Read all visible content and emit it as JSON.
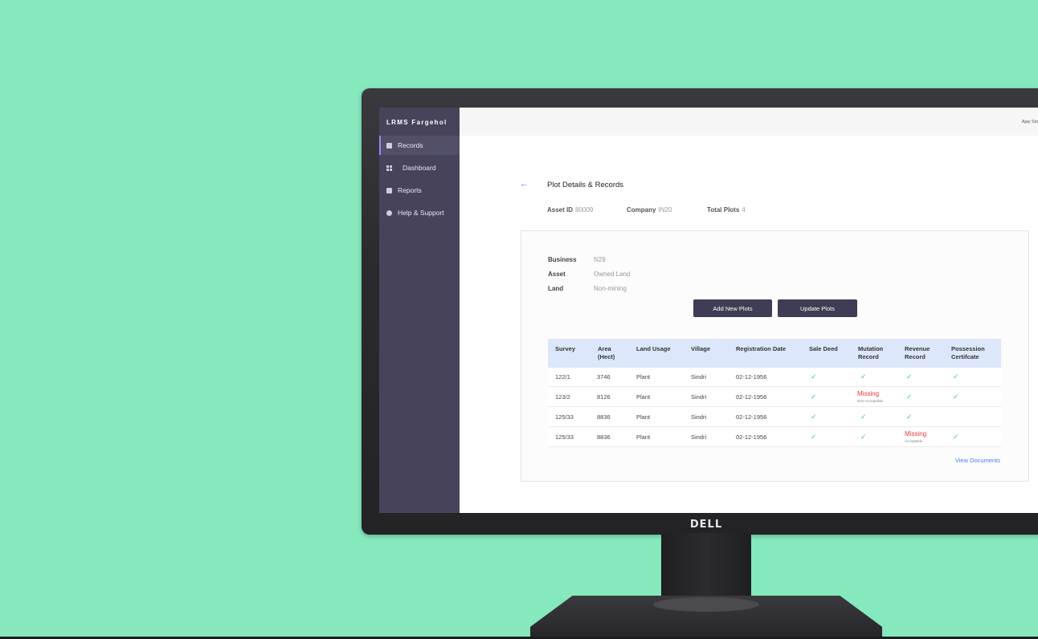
{
  "brand": "DELL",
  "sidebar": {
    "app_title": "LRMS Fargehol",
    "items": [
      {
        "label": "Records",
        "icon": "records-icon"
      },
      {
        "label": "Dashboard",
        "icon": "dashboard-icon"
      },
      {
        "label": "Reports",
        "icon": "reports-icon"
      },
      {
        "label": "Help & Support",
        "icon": "help-icon"
      }
    ]
  },
  "topbar": {
    "user": "Ajay Sin"
  },
  "page": {
    "title": "Plot Details & Records",
    "asset_id_label": "Asset ID",
    "asset_id": "80009",
    "company_label": "Company",
    "company": "IN20",
    "total_plots_label": "Total Plots",
    "total_plots": "4"
  },
  "details": {
    "business_label": "Business",
    "business": "N29",
    "asset_label": "Asset",
    "asset": "Owned Land",
    "land_label": "Land",
    "land": "Non-mining"
  },
  "buttons": {
    "add": "Add New Plots",
    "update": "Update Plots"
  },
  "table": {
    "headers": {
      "survey": "Survey",
      "area": "Area (Hect)",
      "land_usage": "Land Usage",
      "village": "Village",
      "registration_date": "Registration Date",
      "sale_deed": "Sale Deed",
      "mutation_record": "Mutation Record",
      "revenue_record": "Revenue Record",
      "possession_certificate": "Possession Certifcate"
    },
    "check": "✓",
    "rows": [
      {
        "survey": "122/1",
        "area": "3746",
        "land_usage": "Plant",
        "village": "Sindri",
        "date": "02-12-1956"
      },
      {
        "survey": "123/2",
        "area": "8126",
        "land_usage": "Plant",
        "village": "Sindri",
        "date": "02-12-1956",
        "mutation_missing": "Missing",
        "mutation_note": "Non-Acceptable"
      },
      {
        "survey": "125/33",
        "area": "8836",
        "land_usage": "Plant",
        "village": "Sindri",
        "date": "02-12-1956"
      },
      {
        "survey": "125/33",
        "area": "8836",
        "land_usage": "Plant",
        "village": "Sindri",
        "date": "02-12-1956",
        "revenue_missing": "Missing",
        "revenue_note": "Acceptable"
      }
    ]
  },
  "view_documents": "View Documents"
}
